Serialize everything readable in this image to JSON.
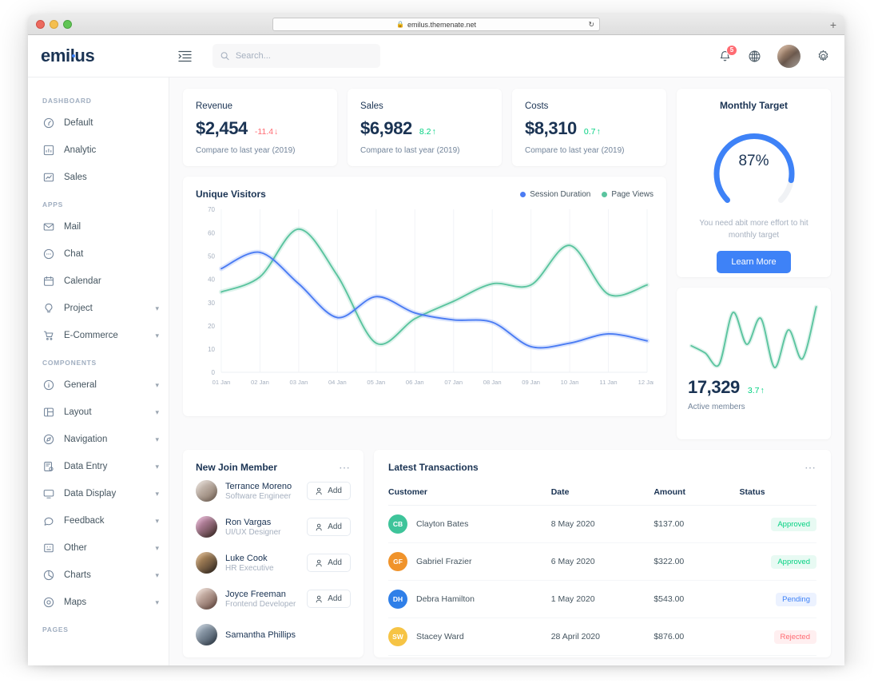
{
  "browser": {
    "url": "emilus.themenate.net",
    "lock_icon": "lock-icon",
    "reload_icon": "reload-icon",
    "newtab_label": "+"
  },
  "header": {
    "logo": "emilus",
    "menu_toggle_icon": "menu-fold-icon",
    "search": {
      "placeholder": "Search...",
      "value": "",
      "icon": "search-icon"
    },
    "notification": {
      "icon": "bell-icon",
      "count": "5",
      "badge_color": "#ff6b72"
    },
    "language_icon": "globe-icon",
    "avatar_icon": "user-avatar",
    "settings_icon": "gear-icon"
  },
  "sidebar": {
    "groups": [
      {
        "title": "DASHBOARD",
        "items": [
          {
            "label": "Default",
            "icon": "dashboard-icon",
            "caret": false
          },
          {
            "label": "Analytic",
            "icon": "analytic-icon",
            "caret": false
          },
          {
            "label": "Sales",
            "icon": "sales-icon",
            "caret": false
          }
        ]
      },
      {
        "title": "APPS",
        "items": [
          {
            "label": "Mail",
            "icon": "mail-icon",
            "caret": false
          },
          {
            "label": "Chat",
            "icon": "chat-icon",
            "caret": false
          },
          {
            "label": "Calendar",
            "icon": "calendar-icon",
            "caret": false
          },
          {
            "label": "Project",
            "icon": "project-icon",
            "caret": true
          },
          {
            "label": "E-Commerce",
            "icon": "cart-icon",
            "caret": true
          }
        ]
      },
      {
        "title": "COMPONENTS",
        "items": [
          {
            "label": "General",
            "icon": "info-icon",
            "caret": true
          },
          {
            "label": "Layout",
            "icon": "layout-icon",
            "caret": true
          },
          {
            "label": "Navigation",
            "icon": "compass-icon",
            "caret": true
          },
          {
            "label": "Data Entry",
            "icon": "data-entry-icon",
            "caret": true
          },
          {
            "label": "Data Display",
            "icon": "display-icon",
            "caret": true
          },
          {
            "label": "Feedback",
            "icon": "feedback-icon",
            "caret": true
          },
          {
            "label": "Other",
            "icon": "other-icon",
            "caret": true
          },
          {
            "label": "Charts",
            "icon": "pie-chart-icon",
            "caret": true
          },
          {
            "label": "Maps",
            "icon": "map-pin-icon",
            "caret": true
          }
        ]
      },
      {
        "title": "PAGES",
        "items": []
      }
    ]
  },
  "stats": [
    {
      "title": "Revenue",
      "value": "$2,454",
      "delta": "-11.4",
      "direction": "down",
      "arrow": "↓",
      "sub": "Compare to last year (2019)"
    },
    {
      "title": "Sales",
      "value": "$6,982",
      "delta": "8.2",
      "direction": "up",
      "arrow": "↑",
      "sub": "Compare to last year (2019)"
    },
    {
      "title": "Costs",
      "value": "$8,310",
      "delta": "0.7",
      "direction": "up",
      "arrow": "↑",
      "sub": "Compare to last year (2019)"
    }
  ],
  "monthly_target": {
    "title": "Monthly Target",
    "percent": "87%",
    "percent_value": 87,
    "note": "You need abit more effort to hit monthly target",
    "button": "Learn More",
    "color": "#3e82f7",
    "track_color": "#f0f2f5"
  },
  "active_members": {
    "count": "17,329",
    "delta": "3.7",
    "arrow": "↑",
    "label": "Active members",
    "color": "#5bc49f"
  },
  "visitors": {
    "title": "Unique Visitors",
    "legend": [
      {
        "label": "Session Duration",
        "color": "#4b7cf3"
      },
      {
        "label": "Page Views",
        "color": "#5bc49f"
      }
    ]
  },
  "new_members": {
    "title": "New Join Member",
    "more_icon": "ellipsis-icon",
    "add_label": "Add",
    "add_icon": "user-add-icon",
    "items": [
      {
        "name": "Terrance Moreno",
        "role": "Software Engineer",
        "avatar_from": "#e3d9d1",
        "avatar_to": "#7e6a5b"
      },
      {
        "name": "Ron Vargas",
        "role": "UI/UX Designer",
        "avatar_from": "#e7a6d0",
        "avatar_to": "#3b2a22"
      },
      {
        "name": "Luke Cook",
        "role": "HR Executive",
        "avatar_from": "#d8a86f",
        "avatar_to": "#2e2621"
      },
      {
        "name": "Joyce Freeman",
        "role": "Frontend Developer",
        "avatar_from": "#f0dcd2",
        "avatar_to": "#6a4b41"
      },
      {
        "name": "Samantha Phillips",
        "role": "",
        "avatar_from": "#b8c7d6",
        "avatar_to": "#2f3c4a"
      }
    ]
  },
  "transactions": {
    "title": "Latest Transactions",
    "more_icon": "ellipsis-icon",
    "columns": [
      "Customer",
      "Date",
      "Amount",
      "Status"
    ],
    "rows": [
      {
        "initials": "CB",
        "avatar_color": "#3ec49a",
        "customer": "Clayton Bates",
        "date": "8 May 2020",
        "amount": "$137.00",
        "status": "Approved",
        "status_type": "approved"
      },
      {
        "initials": "GF",
        "avatar_color": "#f0932b",
        "customer": "Gabriel Frazier",
        "date": "6 May 2020",
        "amount": "$322.00",
        "status": "Approved",
        "status_type": "approved"
      },
      {
        "initials": "DH",
        "avatar_color": "#2f7fe8",
        "customer": "Debra Hamilton",
        "date": "1 May 2020",
        "amount": "$543.00",
        "status": "Pending",
        "status_type": "pending"
      },
      {
        "initials": "SW",
        "avatar_color": "#f6c445",
        "customer": "Stacey Ward",
        "date": "28 April 2020",
        "amount": "$876.00",
        "status": "Rejected",
        "status_type": "rejected"
      }
    ]
  },
  "chart_data": {
    "type": "line",
    "title": "Unique Visitors",
    "x": [
      "01 Jan",
      "02 Jan",
      "03 Jan",
      "04 Jan",
      "05 Jan",
      "06 Jan",
      "07 Jan",
      "08 Jan",
      "09 Jan",
      "10 Jan",
      "11 Jan",
      "12 Jan"
    ],
    "xlabel": "",
    "ylabel": "",
    "ylim": [
      0,
      70
    ],
    "yticks": [
      0,
      10,
      20,
      30,
      40,
      50,
      60,
      70
    ],
    "grid": true,
    "legend_position": "top-right",
    "series": [
      {
        "name": "Session Duration",
        "color": "#4b7cf3",
        "values": [
          44.5,
          51.5,
          38,
          23.5,
          32.5,
          25.5,
          22.5,
          21.5,
          11,
          12.5,
          16.5,
          13.5
        ]
      },
      {
        "name": "Page Views",
        "color": "#5bc49f",
        "values": [
          34.5,
          41,
          61.5,
          41.5,
          12.5,
          23,
          30.5,
          38,
          37.5,
          54.5,
          33.5,
          37.5
        ]
      }
    ]
  },
  "sparkline_data": {
    "type": "line",
    "color": "#5bc49f",
    "values": [
      35,
      30,
      22,
      58,
      36,
      54,
      20,
      46,
      26,
      62
    ]
  }
}
